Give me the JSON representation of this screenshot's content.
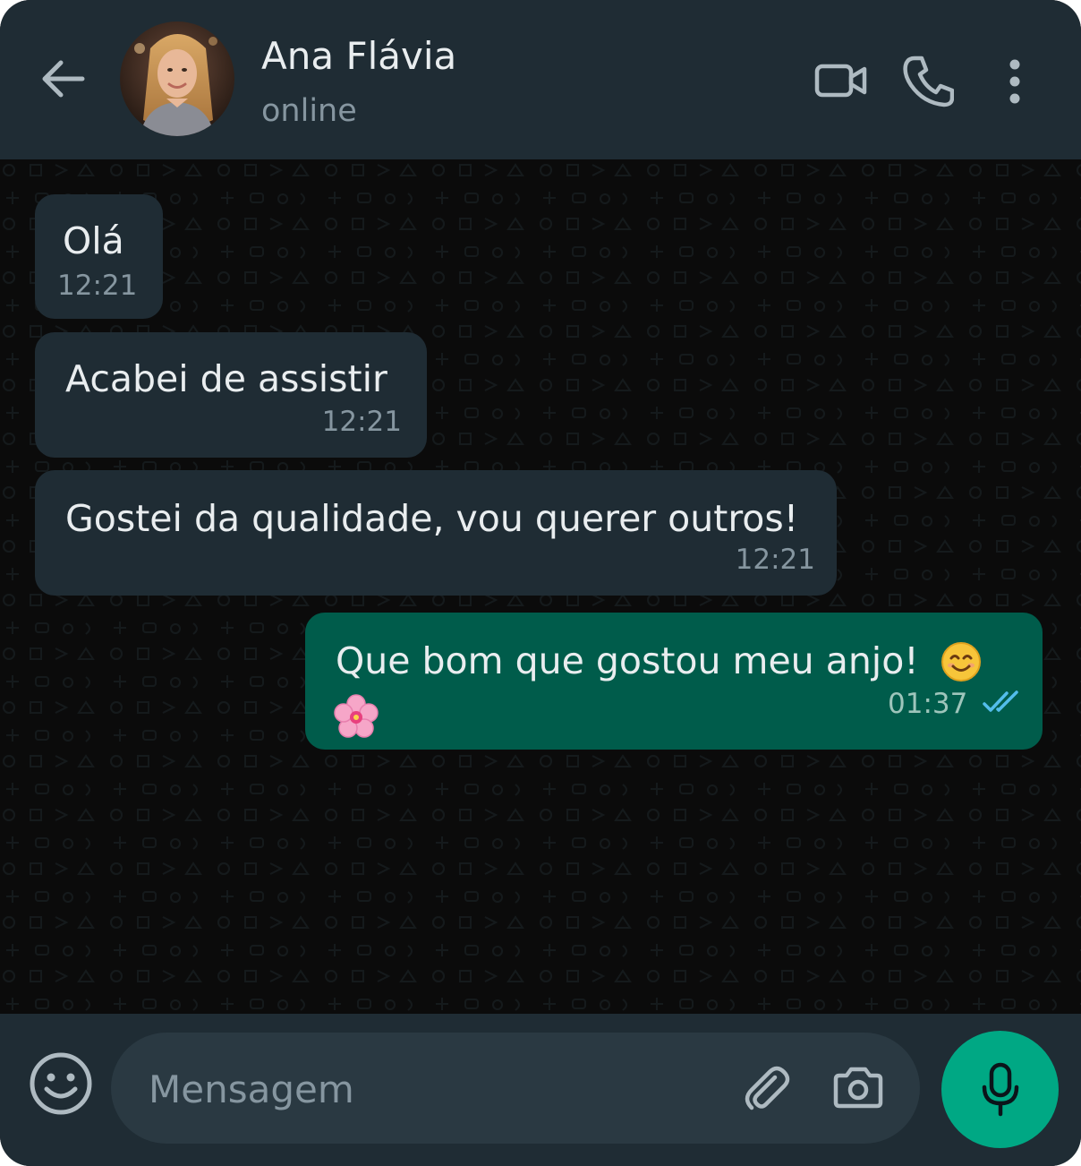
{
  "header": {
    "contact_name": "Ana Flávia",
    "status": "online"
  },
  "messages": [
    {
      "direction": "incoming",
      "text": "Olá",
      "time": "12:21"
    },
    {
      "direction": "incoming",
      "text": "Acabei de assistir",
      "time": "12:21"
    },
    {
      "direction": "incoming",
      "text": "Gostei da qualidade, vou querer outros!",
      "time": "12:21"
    },
    {
      "direction": "outgoing",
      "text": "Que bom que gostou meu anjo!",
      "emojis": [
        "smiling-face-emoji",
        "cherry-blossom-emoji"
      ],
      "time": "01:37",
      "status": "read"
    }
  ],
  "composer": {
    "placeholder": "Mensagem"
  },
  "colors": {
    "header_bg": "#1f2c34",
    "chat_bg": "#0b0b0b",
    "incoming_bubble": "#1f2c34",
    "outgoing_bubble": "#005c4b",
    "accent": "#00a884",
    "read_ticks": "#53bdeb"
  },
  "icons": {
    "back": "arrow-left-icon",
    "video": "video-camera-icon",
    "call": "phone-icon",
    "menu": "more-vertical-icon",
    "emoji": "smiley-icon",
    "attach": "paperclip-icon",
    "camera": "camera-icon",
    "mic": "microphone-icon"
  }
}
